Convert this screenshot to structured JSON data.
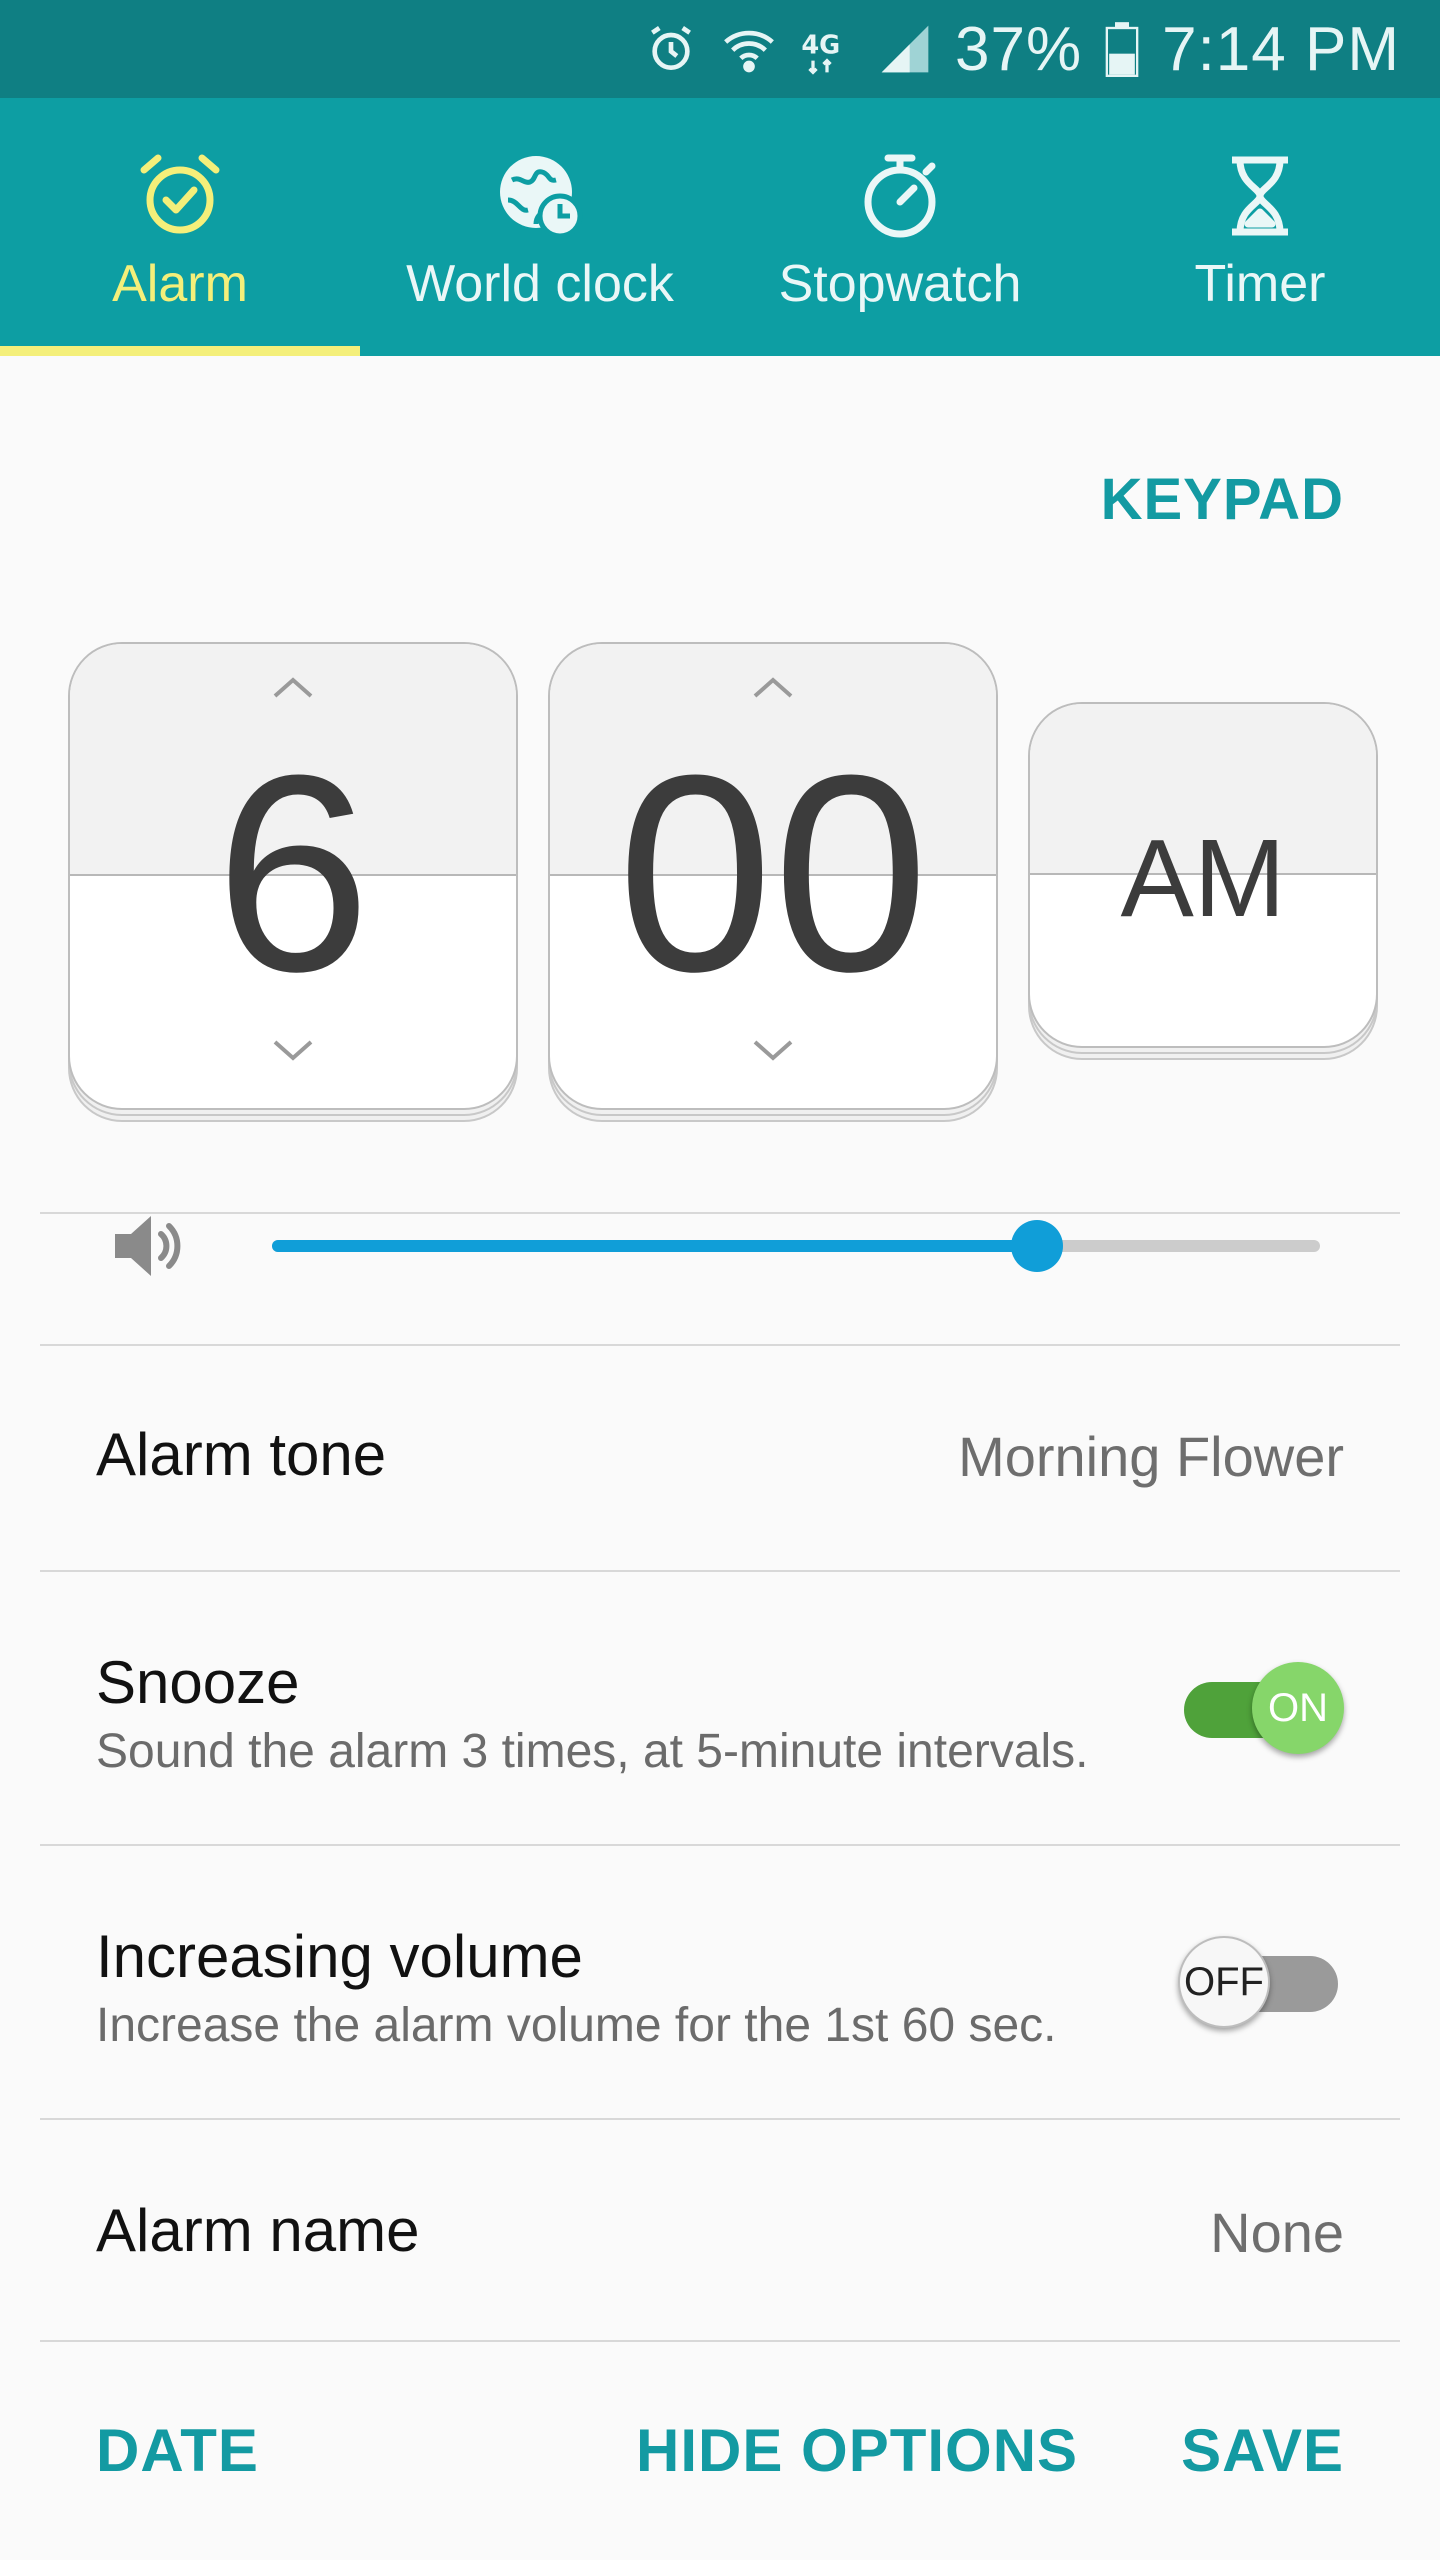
{
  "status_bar": {
    "battery": "37%",
    "time": "7:14 PM",
    "icons": [
      "alarm-icon",
      "wifi-icon",
      "lte-icon",
      "signal-icon",
      "battery-icon"
    ]
  },
  "tabs": [
    {
      "label": "Alarm",
      "icon": "alarm-clock-icon",
      "active": true
    },
    {
      "label": "World clock",
      "icon": "world-clock-icon",
      "active": false
    },
    {
      "label": "Stopwatch",
      "icon": "stopwatch-icon",
      "active": false
    },
    {
      "label": "Timer",
      "icon": "hourglass-icon",
      "active": false
    }
  ],
  "keypad_label": "KEYPAD",
  "time_picker": {
    "hour": "6",
    "minute": "00",
    "ampm": "AM"
  },
  "volume": {
    "icon": "speaker-icon",
    "level": 0.73
  },
  "settings": {
    "alarm_tone": {
      "label": "Alarm tone",
      "value": "Morning Flower"
    },
    "snooze": {
      "label": "Snooze",
      "description": "Sound the alarm 3 times, at 5-minute intervals.",
      "state": "ON"
    },
    "increasing_volume": {
      "label": "Increasing volume",
      "description": "Increase the alarm volume for the 1st 60 sec.",
      "state": "OFF"
    },
    "alarm_name": {
      "label": "Alarm name",
      "value": "None"
    }
  },
  "bottom_actions": {
    "date": "DATE",
    "hide_options": "HIDE OPTIONS",
    "save": "SAVE"
  },
  "colors": {
    "status_bar": "#0f7f83",
    "tab_bar": "#0d9ea3",
    "active_tab": "#f4ef7a",
    "accent": "#139aa2",
    "slider": "#109ed8",
    "toggle_on": "#86d66a"
  }
}
